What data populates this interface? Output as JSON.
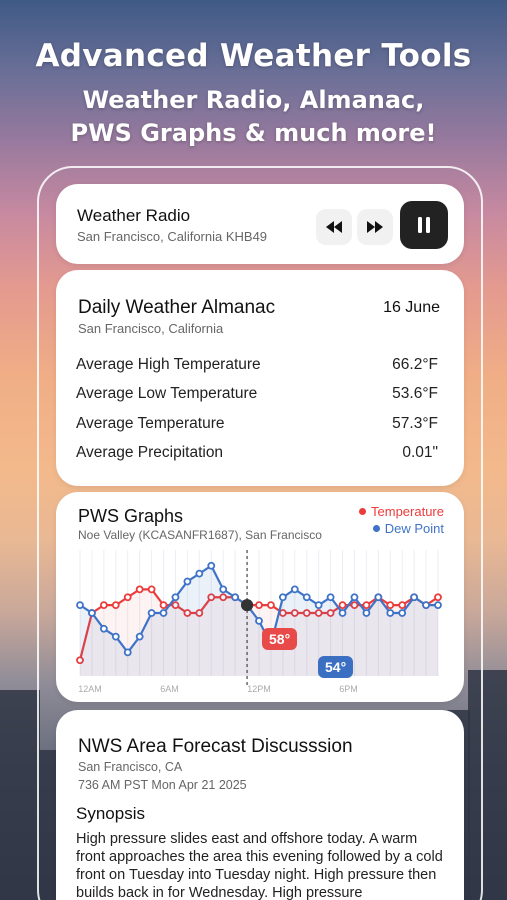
{
  "headline": {
    "title": "Advanced Weather Tools",
    "subtitle_line1": "Weather Radio, Almanac,",
    "subtitle_line2": "PWS Graphs & much more!"
  },
  "radio": {
    "title": "Weather Radio",
    "station": "San Francisco, California KHB49",
    "icons": [
      "rewind-icon",
      "fast-forward-icon",
      "pause-icon"
    ]
  },
  "almanac": {
    "title": "Daily Weather Almanac",
    "date": "16 June",
    "location": "San Francisco, California",
    "rows": [
      {
        "label": "Average High Temperature",
        "value": "66.2°F"
      },
      {
        "label": "Average Low Temperature",
        "value": "53.6°F"
      },
      {
        "label": "Average Temperature",
        "value": "57.3°F"
      },
      {
        "label": "Average Precipitation",
        "value": "0.01\""
      }
    ]
  },
  "pws": {
    "title": "PWS Graphs",
    "station": "Noe Valley (KCASANFR1687), San Francisco",
    "legend_temperature": "Temperature",
    "legend_dewpoint": "Dew Point",
    "badge_temperature": "58°",
    "badge_dewpoint": "54°",
    "colors": {
      "temperature": "#ec3b3b",
      "dewpoint": "#3e73c7"
    }
  },
  "chart_data": {
    "type": "line",
    "x_ticks": [
      "12AM",
      "6AM",
      "12PM",
      "6PM"
    ],
    "series": [
      {
        "name": "Temperature",
        "values": [
          50,
          56,
          57,
          57,
          58,
          59,
          59,
          57,
          57,
          56,
          56,
          58,
          58,
          58,
          57,
          57,
          57,
          56,
          56,
          56,
          56,
          56,
          57,
          57,
          57,
          58,
          57,
          57,
          58,
          57,
          58
        ]
      },
      {
        "name": "Dew Point",
        "values": [
          57,
          56,
          54,
          53,
          51,
          53,
          56,
          56,
          58,
          60,
          61,
          62,
          59,
          58,
          57,
          55,
          52,
          58,
          59,
          58,
          57,
          58,
          56,
          58,
          56,
          58,
          56,
          56,
          58,
          57,
          57
        ]
      }
    ],
    "cursor_index": 14,
    "ylim": [
      48,
      64
    ]
  },
  "nws": {
    "title": "NWS Area Forecast Discusssion",
    "location": "San Francisco, CA",
    "issued": "736 AM PST Mon Apr 21 2025",
    "section": "Synopsis",
    "body": "High pressure slides east and offshore today. A warm front approaches the area this evening followed by a cold front on Tuesday into Tuesday night. High pressure then builds back in for Wednesday. High pressure"
  }
}
